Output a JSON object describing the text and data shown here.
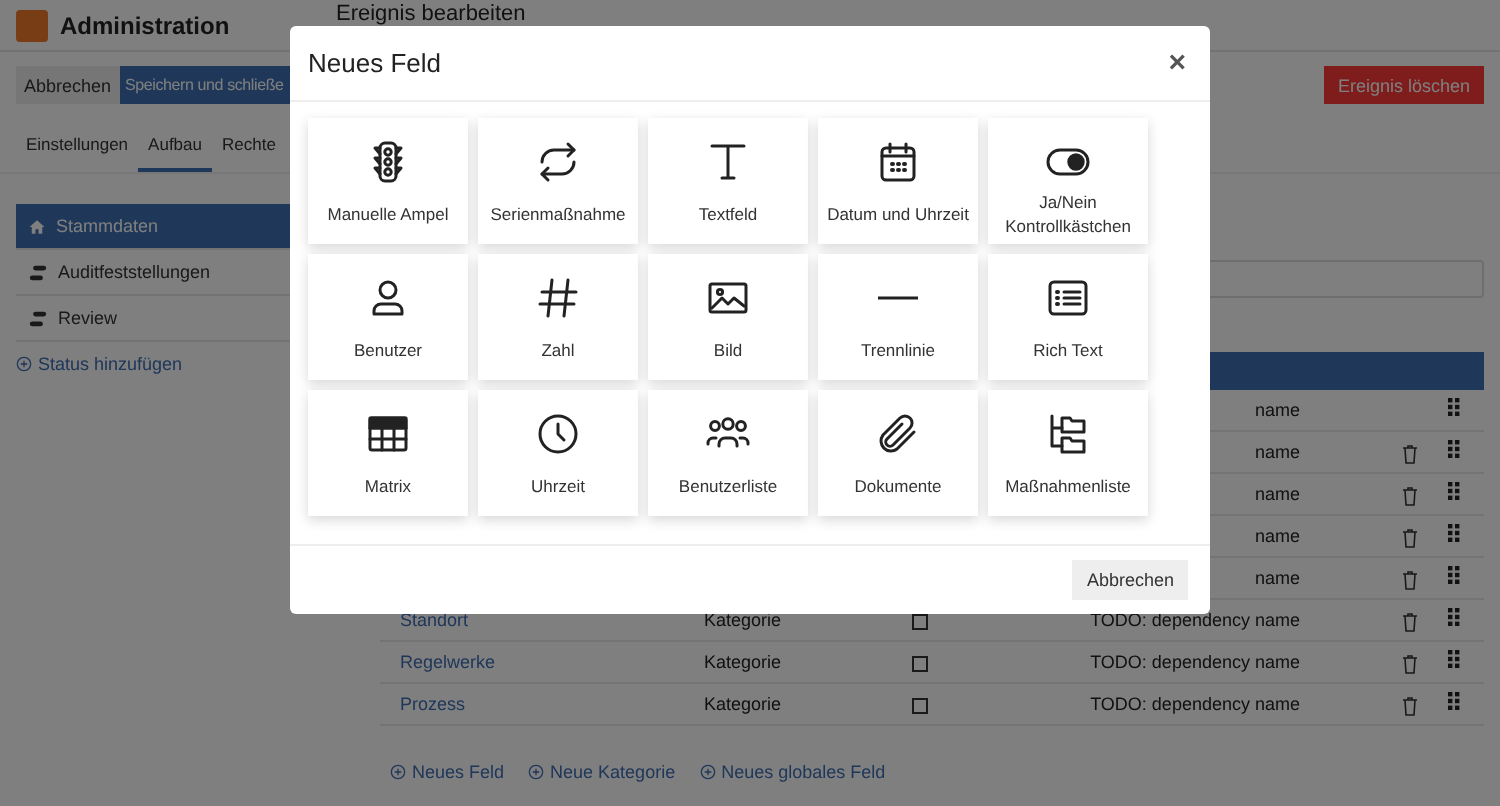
{
  "header": {
    "app_title": "Administration",
    "page_title": "Ereignis bearbeiten"
  },
  "toolbar": {
    "cancel": "Abbrechen",
    "save": "Speichern und schließe",
    "delete": "Ereignis löschen"
  },
  "tabs": [
    {
      "label": "Einstellungen",
      "selected": false
    },
    {
      "label": "Aufbau",
      "selected": true
    },
    {
      "label": "Rechte",
      "selected": false
    }
  ],
  "sidebar": {
    "items": [
      {
        "label": "Stammdaten",
        "kind": "home",
        "selected": true
      },
      {
        "label": "Auditfeststellungen",
        "kind": "status",
        "selected": false
      },
      {
        "label": "Review",
        "kind": "status",
        "selected": false
      }
    ],
    "add_link": "Status hinzufügen"
  },
  "table": {
    "rows": [
      {
        "dependency": "name",
        "deletable": false
      },
      {
        "dependency": "name",
        "deletable": true
      },
      {
        "dependency": "name",
        "deletable": true
      },
      {
        "dependency": "name",
        "deletable": true
      },
      {
        "dependency": "name",
        "deletable": true
      },
      {
        "name": "Standort",
        "category": "Kategorie",
        "checked": false,
        "dependency": "TODO: dependency name",
        "deletable": true
      },
      {
        "name": "Regelwerke",
        "category": "Kategorie",
        "checked": false,
        "dependency": "TODO: dependency name",
        "deletable": true
      },
      {
        "name": "Prozess",
        "category": "Kategorie",
        "checked": false,
        "dependency": "TODO: dependency name",
        "deletable": true
      }
    ]
  },
  "footer_links": [
    "Neues Feld",
    "Neue Kategorie",
    "Neues globales Feld"
  ],
  "dialog": {
    "title": "Neues Feld",
    "close": "×",
    "options": [
      {
        "label": "Manuelle Ampel"
      },
      {
        "label": "Serienmaßnahme"
      },
      {
        "label": "Textfeld"
      },
      {
        "label": "Datum und Uhrzeit"
      },
      {
        "label": "Ja/Nein Kontrollkästchen"
      },
      {
        "label": "Benutzer"
      },
      {
        "label": "Zahl"
      },
      {
        "label": "Bild"
      },
      {
        "label": "Trennlinie"
      },
      {
        "label": "Rich Text"
      },
      {
        "label": "Matrix"
      },
      {
        "label": "Uhrzeit"
      },
      {
        "label": "Benutzerliste"
      },
      {
        "label": "Dokumente"
      },
      {
        "label": "Maßnahmenliste"
      }
    ],
    "cancel": "Abbrechen"
  }
}
